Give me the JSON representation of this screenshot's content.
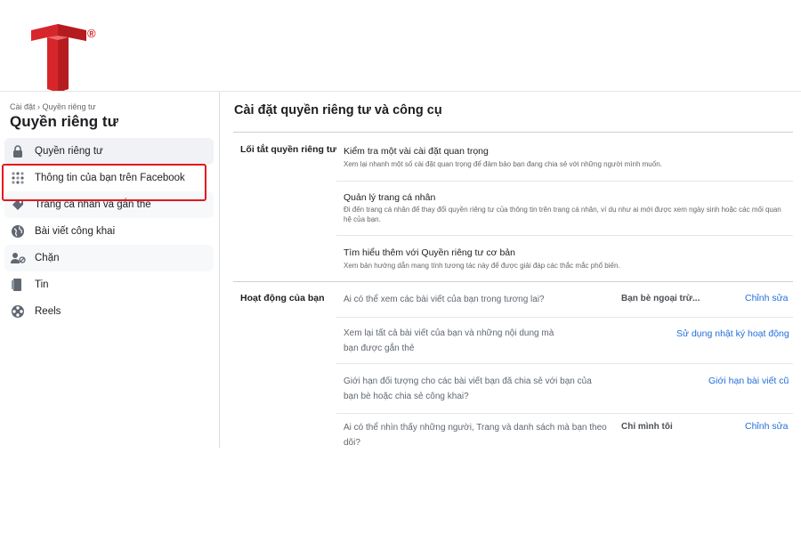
{
  "brand": {
    "logo_mark": "T",
    "registered": "®",
    "logo_color": "#d7262b"
  },
  "sidebar": {
    "breadcrumb": "Cài đặt › Quyền riêng tư",
    "title": "Quyền riêng tư",
    "items": [
      {
        "label": "Quyền riêng tư",
        "icon": "lock-person-icon",
        "active": true
      },
      {
        "label": "Thông tin của bạn trên Facebook",
        "icon": "grid-dots-icon",
        "highlighted": true
      },
      {
        "label": "Trang cá nhân và gắn thẻ",
        "icon": "tag-icon"
      },
      {
        "label": "Bài viết công khai",
        "icon": "globe-icon"
      },
      {
        "label": "Chặn",
        "icon": "block-user-icon"
      },
      {
        "label": "Tin",
        "icon": "book-icon"
      },
      {
        "label": "Reels",
        "icon": "film-reel-icon"
      }
    ]
  },
  "main": {
    "title": "Cài đặt quyền riêng tư và công cụ",
    "shortcuts": {
      "label": "Lối tắt quyền riêng tư",
      "rows": [
        {
          "title": "Kiểm tra một vài cài đặt quan trọng",
          "desc": "Xem lại nhanh một số cài đặt quan trọng để đảm bảo bạn đang chia sẻ với những người mình muốn."
        },
        {
          "title": "Quản lý trang cá nhân",
          "desc": "Đi đến trang cá nhân để thay đổi quyền riêng tư của thông tin trên trang cá nhân, ví dụ như ai mới được xem ngày sinh hoặc các mối quan hệ của bạn."
        },
        {
          "title": "Tìm hiểu thêm với Quyền riêng tư cơ bản",
          "desc": "Xem bản hướng dẫn mang tính tương tác này để được giải đáp các thắc mắc phổ biến."
        }
      ]
    },
    "activity": {
      "label": "Hoạt động của bạn",
      "rows": [
        {
          "text": "Ai có thể xem các bài viết của bạn trong tương lai?",
          "value": "Bạn bè ngoại trừ...",
          "link": "Chỉnh sửa"
        },
        {
          "text": "Xem lại tất cả bài viết của bạn và những nội dung mà bạn được gắn thẻ",
          "value": "",
          "link": "Sử dụng nhật ký hoạt động"
        },
        {
          "text": "Giới hạn đối tượng cho các bài viết bạn đã chia sẻ với bạn của bạn bè hoặc chia sẻ công khai?",
          "value": "",
          "link": "Giới hạn bài viết cũ"
        },
        {
          "text": "Ai có thể nhìn thấy những người, Trang và danh sách mà bạn theo dõi?",
          "value": "Chỉ mình tôi",
          "link": "Chỉnh sửa"
        }
      ]
    }
  },
  "colors": {
    "link": "#216fdb",
    "highlight_border": "#e3161e"
  }
}
